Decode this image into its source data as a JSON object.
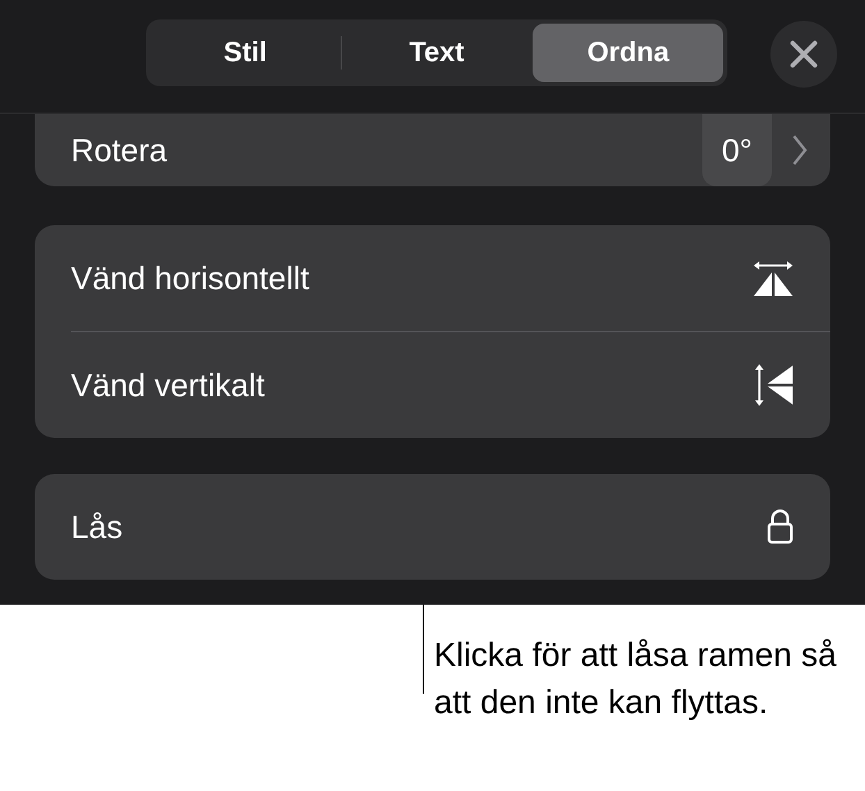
{
  "tabs": [
    {
      "label": "Stil",
      "selected": false
    },
    {
      "label": "Text",
      "selected": false
    },
    {
      "label": "Ordna",
      "selected": true
    }
  ],
  "rotate": {
    "label": "Rotera",
    "value": "0°"
  },
  "flip_rows": [
    {
      "label": "Vänd horisontellt",
      "kind": "horizontal"
    },
    {
      "label": "Vänd vertikalt",
      "kind": "vertical"
    }
  ],
  "lock": {
    "label": "Lås"
  },
  "callout": "Klicka för att låsa ramen så att den inte kan flyttas."
}
